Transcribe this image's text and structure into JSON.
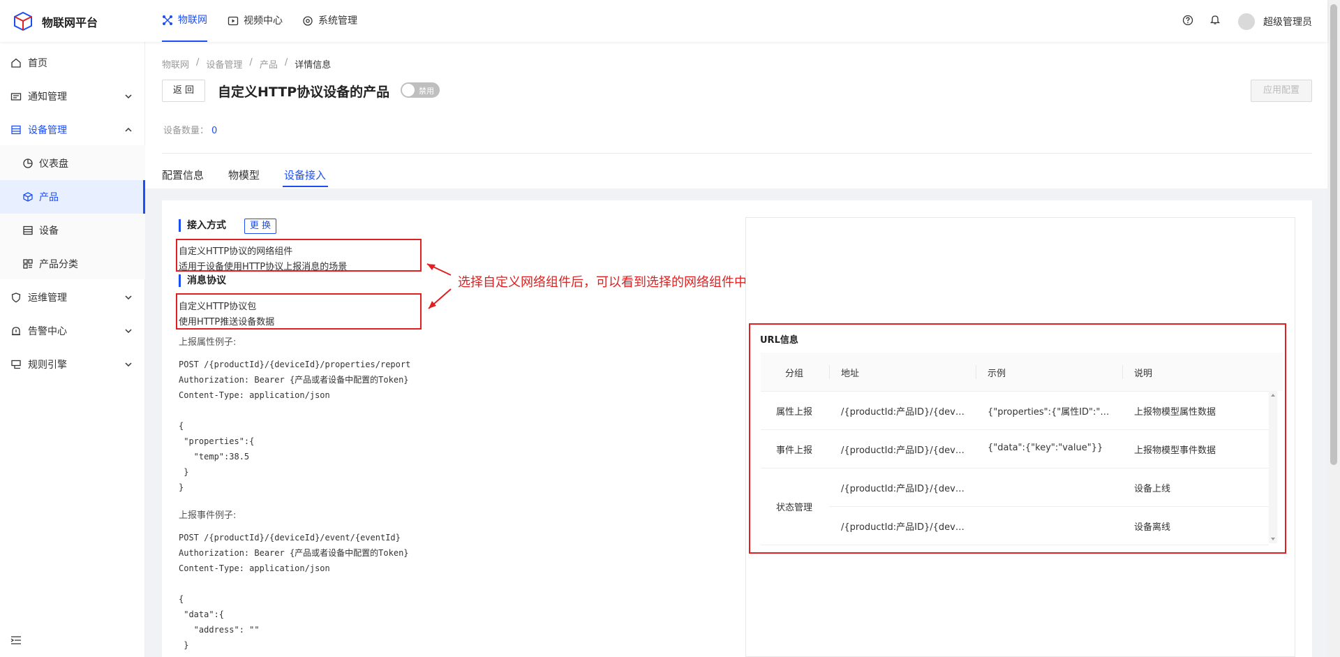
{
  "app": {
    "title": "物联网平台"
  },
  "topnav": [
    {
      "label": "物联网",
      "icon": "iot-icon"
    },
    {
      "label": "视频中心",
      "icon": "video-icon"
    },
    {
      "label": "系统管理",
      "icon": "system-icon"
    }
  ],
  "user": {
    "name": "超级管理员"
  },
  "sidebar": {
    "items": [
      {
        "label": "首页",
        "icon": "home-icon"
      },
      {
        "label": "通知管理",
        "icon": "notice-icon"
      },
      {
        "label": "设备管理",
        "icon": "device-manage-icon"
      },
      {
        "label": "仪表盘",
        "icon": "dashboard-icon"
      },
      {
        "label": "产品",
        "icon": "product-icon"
      },
      {
        "label": "设备",
        "icon": "device-icon"
      },
      {
        "label": "产品分类",
        "icon": "category-icon"
      },
      {
        "label": "运维管理",
        "icon": "ops-icon"
      },
      {
        "label": "告警中心",
        "icon": "alarm-icon"
      },
      {
        "label": "规则引擎",
        "icon": "rule-icon"
      }
    ]
  },
  "breadcrumb": [
    "物联网",
    "/",
    "设备管理",
    "/",
    "产品",
    "/",
    "详情信息"
  ],
  "header": {
    "back_label": "返 回",
    "title": "自定义HTTP协议设备的产品",
    "toggle_label": "禁用",
    "apply_label": "应用配置",
    "count_label": "设备数量：",
    "count_value": "0"
  },
  "tabs": [
    "配置信息",
    "物模型",
    "设备接入"
  ],
  "access": {
    "section_title": "接入方式",
    "change_label": "更 换",
    "component_name": "自定义HTTP协议的网络组件",
    "component_desc": "适用于设备使用HTTP协议上报消息的场景",
    "protocol_title": "消息协议",
    "protocol_name": "自定义HTTP协议包",
    "protocol_desc": "使用HTTP推送设备数据",
    "report_prop_label": "上报属性例子:",
    "report_prop_code": "POST /{productId}/{deviceId}/properties/report\nAuthorization: Bearer {产品或者设备中配置的Token}\nContent-Type: application/json\n\n{\n \"properties\":{\n   \"temp\":38.5\n }\n}",
    "report_event_label": "上报事件例子:",
    "report_event_code": "POST /{productId}/{deviceId}/event/{eventId}\nAuthorization: Bearer {产品或者设备中配置的Token}\nContent-Type: application/json\n\n{\n \"data\":{\n   \"address\": \"\"\n }"
  },
  "annotation": "选择自定义网络组件后，可以看到选择的网络组件中的：协议包信息和网络组件信息",
  "url_info": {
    "title": "URL信息",
    "columns": [
      "分组",
      "地址",
      "示例",
      "说明"
    ],
    "rows": [
      {
        "group": "属性上报",
        "address": "/{productId:产品ID}/{dev…",
        "example": "{\"properties\":{\"属性ID\":\"…",
        "desc": "上报物模型属性数据"
      },
      {
        "group": "事件上报",
        "address": "/{productId:产品ID}/{dev…",
        "example": "{\"data\":{\"key\":\"value\"}}",
        "desc": "上报物模型事件数据"
      },
      {
        "group": "状态管理",
        "address": "/{productId:产品ID}/{dev…",
        "example": "",
        "desc": "设备上线"
      },
      {
        "group": "",
        "address": "/{productId:产品ID}/{dev…",
        "example": "",
        "desc": "设备离线"
      }
    ]
  },
  "colors": {
    "accent": "#1d4ef5",
    "annotation": "#e02020"
  }
}
